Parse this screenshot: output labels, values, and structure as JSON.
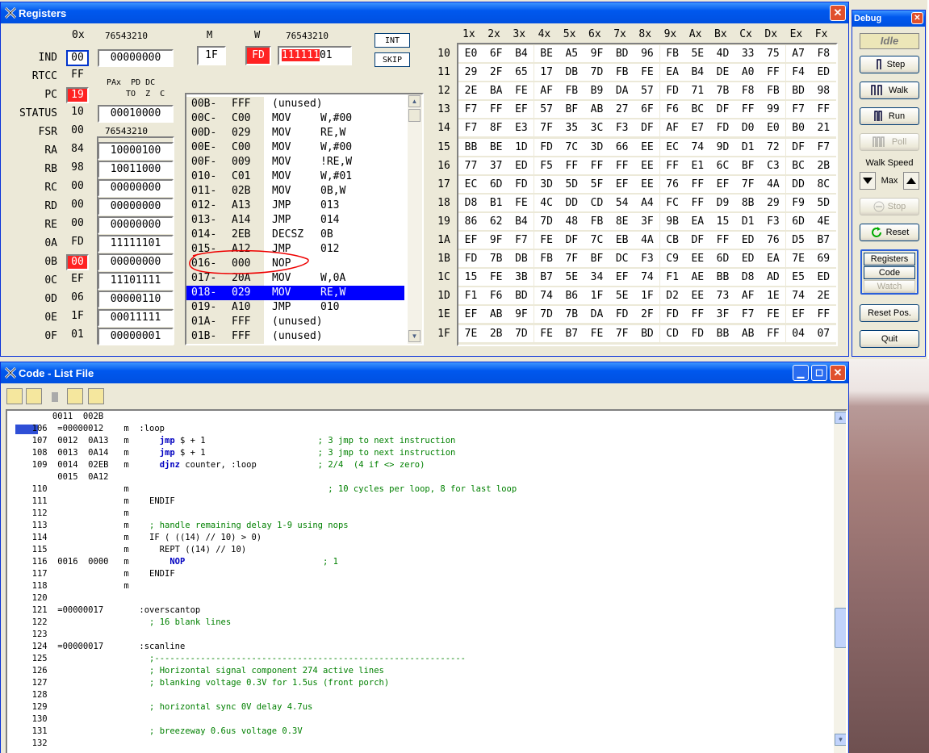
{
  "registers_window": {
    "title": "Registers",
    "hdr_0x": "0x",
    "hdr_bits1": "76543210",
    "hdr_m": "M",
    "hdr_w": "W",
    "hdr_bits2": "76543210",
    "m_value": "1F",
    "w_value": "FD",
    "w_binary_red": "111111",
    "w_binary_rest": "01",
    "btn_int": "INT",
    "btn_skip": "SKIP",
    "status_hdr1": "PAx  PD DC",
    "status_hdr2": "TO  Z  C",
    "hdr_bits3": "76543210",
    "regs": [
      {
        "name": "IND",
        "hex": "00",
        "bin": "00000000",
        "hexstyle": "blue"
      },
      {
        "name": "RTCC",
        "hex": "FF",
        "bin": "",
        "hexstyle": "flat"
      },
      {
        "name": "PC",
        "hex": "19",
        "bin": "",
        "hexstyle": "red"
      },
      {
        "name": "STATUS",
        "hex": "10",
        "bin": "00010000",
        "hexstyle": "flat"
      },
      {
        "name": "FSR",
        "hex": "00",
        "bin": "",
        "hexstyle": "flat"
      },
      {
        "name": "RA",
        "hex": "84",
        "bin": "10000100",
        "hexstyle": "flat"
      },
      {
        "name": "RB",
        "hex": "98",
        "bin": "10011000",
        "hexstyle": "flat"
      },
      {
        "name": "RC",
        "hex": "00",
        "bin": "00000000",
        "hexstyle": "flat"
      },
      {
        "name": "RD",
        "hex": "00",
        "bin": "00000000",
        "hexstyle": "flat"
      },
      {
        "name": "RE",
        "hex": "00",
        "bin": "00000000",
        "hexstyle": "flat"
      },
      {
        "name": "0A",
        "hex": "FD",
        "bin": "11111101",
        "hexstyle": "flat"
      },
      {
        "name": "0B",
        "hex": "00",
        "bin": "00000000",
        "hexstyle": "red"
      },
      {
        "name": "0C",
        "hex": "EF",
        "bin": "11101111",
        "hexstyle": "flat"
      },
      {
        "name": "0D",
        "hex": "06",
        "bin": "00000110",
        "hexstyle": "flat"
      },
      {
        "name": "0E",
        "hex": "1F",
        "bin": "00011111",
        "hexstyle": "flat"
      },
      {
        "name": "0F",
        "hex": "01",
        "bin": "00000001",
        "hexstyle": "flat"
      }
    ],
    "disasm": [
      {
        "addr": "00B-",
        "op": "FFF",
        "mn": "(unused)",
        "arg": ""
      },
      {
        "addr": "00C-",
        "op": "C00",
        "mn": "MOV",
        "arg": "W,#00"
      },
      {
        "addr": "00D-",
        "op": "029",
        "mn": "MOV",
        "arg": "RE,W"
      },
      {
        "addr": "00E-",
        "op": "C00",
        "mn": "MOV",
        "arg": "W,#00"
      },
      {
        "addr": "00F-",
        "op": "009",
        "mn": "MOV",
        "arg": "!RE,W"
      },
      {
        "addr": "010-",
        "op": "C01",
        "mn": "MOV",
        "arg": "W,#01"
      },
      {
        "addr": "011-",
        "op": "02B",
        "mn": "MOV",
        "arg": "0B,W"
      },
      {
        "addr": "012-",
        "op": "A13",
        "mn": "JMP",
        "arg": "013"
      },
      {
        "addr": "013-",
        "op": "A14",
        "mn": "JMP",
        "arg": "014"
      },
      {
        "addr": "014-",
        "op": "2EB",
        "mn": "DECSZ",
        "arg": "0B"
      },
      {
        "addr": "015-",
        "op": "A12",
        "mn": "JMP",
        "arg": "012"
      },
      {
        "addr": "016-",
        "op": "000",
        "mn": "NOP",
        "arg": ""
      },
      {
        "addr": "017-",
        "op": "20A",
        "mn": "MOV",
        "arg": "W,0A"
      },
      {
        "addr": "018-",
        "op": "029",
        "mn": "MOV",
        "arg": "RE,W"
      },
      {
        "addr": "019-",
        "op": "A10",
        "mn": "JMP",
        "arg": "010"
      },
      {
        "addr": "01A-",
        "op": "FFF",
        "mn": "(unused)",
        "arg": ""
      },
      {
        "addr": "01B-",
        "op": "FFF",
        "mn": "(unused)",
        "arg": ""
      }
    ],
    "disasm_selected": 13,
    "mem_cols": [
      "1x",
      "2x",
      "3x",
      "4x",
      "5x",
      "6x",
      "7x",
      "8x",
      "9x",
      "Ax",
      "Bx",
      "Cx",
      "Dx",
      "Ex",
      "Fx"
    ],
    "mem_rows": [
      {
        "label": "10",
        "vals": [
          "E0",
          "6F",
          "B4",
          "BE",
          "A5",
          "9F",
          "BD",
          "96",
          "FB",
          "5E",
          "4D",
          "33",
          "75",
          "A7",
          "F8"
        ]
      },
      {
        "label": "11",
        "vals": [
          "29",
          "2F",
          "65",
          "17",
          "DB",
          "7D",
          "FB",
          "FE",
          "EA",
          "B4",
          "DE",
          "A0",
          "FF",
          "F4",
          "ED"
        ]
      },
      {
        "label": "12",
        "vals": [
          "2E",
          "BA",
          "FE",
          "AF",
          "FB",
          "B9",
          "DA",
          "57",
          "FD",
          "71",
          "7B",
          "F8",
          "FB",
          "BD",
          "98"
        ]
      },
      {
        "label": "13",
        "vals": [
          "F7",
          "FF",
          "EF",
          "57",
          "BF",
          "AB",
          "27",
          "6F",
          "F6",
          "BC",
          "DF",
          "FF",
          "99",
          "F7",
          "FF"
        ]
      },
      {
        "label": "14",
        "vals": [
          "F7",
          "8F",
          "E3",
          "7F",
          "35",
          "3C",
          "F3",
          "DF",
          "AF",
          "E7",
          "FD",
          "D0",
          "E0",
          "B0",
          "21"
        ]
      },
      {
        "label": "15",
        "vals": [
          "BB",
          "BE",
          "1D",
          "FD",
          "7C",
          "3D",
          "66",
          "EE",
          "EC",
          "74",
          "9D",
          "D1",
          "72",
          "DF",
          "F7"
        ]
      },
      {
        "label": "16",
        "vals": [
          "77",
          "37",
          "ED",
          "F5",
          "FF",
          "FF",
          "FF",
          "EE",
          "FF",
          "E1",
          "6C",
          "BF",
          "C3",
          "BC",
          "2B"
        ]
      },
      {
        "label": "17",
        "vals": [
          "EC",
          "6D",
          "FD",
          "3D",
          "5D",
          "5F",
          "EF",
          "EE",
          "76",
          "FF",
          "EF",
          "7F",
          "4A",
          "DD",
          "8C"
        ]
      },
      {
        "label": "18",
        "vals": [
          "D8",
          "B1",
          "FE",
          "4C",
          "DD",
          "CD",
          "54",
          "A4",
          "FC",
          "FF",
          "D9",
          "8B",
          "29",
          "F9",
          "5D"
        ]
      },
      {
        "label": "19",
        "vals": [
          "86",
          "62",
          "B4",
          "7D",
          "48",
          "FB",
          "8E",
          "3F",
          "9B",
          "EA",
          "15",
          "D1",
          "F3",
          "6D",
          "4E"
        ]
      },
      {
        "label": "1A",
        "vals": [
          "EF",
          "9F",
          "F7",
          "FE",
          "DF",
          "7C",
          "EB",
          "4A",
          "CB",
          "DF",
          "FF",
          "ED",
          "76",
          "D5",
          "B7"
        ]
      },
      {
        "label": "1B",
        "vals": [
          "FD",
          "7B",
          "DB",
          "FB",
          "7F",
          "BF",
          "DC",
          "F3",
          "C9",
          "EE",
          "6D",
          "ED",
          "EA",
          "7E",
          "69"
        ]
      },
      {
        "label": "1C",
        "vals": [
          "15",
          "FE",
          "3B",
          "B7",
          "5E",
          "34",
          "EF",
          "74",
          "F1",
          "AE",
          "BB",
          "D8",
          "AD",
          "E5",
          "ED"
        ]
      },
      {
        "label": "1D",
        "vals": [
          "F1",
          "F6",
          "BD",
          "74",
          "B6",
          "1F",
          "5E",
          "1F",
          "D2",
          "EE",
          "73",
          "AF",
          "1E",
          "74",
          "2E"
        ]
      },
      {
        "label": "1E",
        "vals": [
          "EF",
          "AB",
          "9F",
          "7D",
          "7B",
          "DA",
          "FD",
          "2F",
          "FD",
          "FF",
          "3F",
          "F7",
          "FE",
          "EF",
          "FF"
        ]
      },
      {
        "label": "1F",
        "vals": [
          "7E",
          "2B",
          "7D",
          "FE",
          "B7",
          "FE",
          "7F",
          "BD",
          "CD",
          "FD",
          "BB",
          "AB",
          "FF",
          "04",
          "07"
        ]
      }
    ]
  },
  "debug_window": {
    "title": "Debug",
    "status": "Idle",
    "step": "Step",
    "walk": "Walk",
    "run": "Run",
    "poll": "Poll",
    "walk_speed_label": "Walk Speed",
    "max_label": "Max",
    "stop": "Stop",
    "reset": "Reset",
    "tab_registers": "Registers",
    "tab_code": "Code",
    "tab_watch": "Watch",
    "reset_pos": "Reset Pos.",
    "quit": "Quit"
  },
  "code_window": {
    "title": "Code - List File",
    "lines": [
      {
        "t": "      0011  002B",
        "c": ""
      },
      {
        "t": "  106  =00000012    m  :loop",
        "c": "",
        "sel": true
      },
      {
        "t": "  107  0012  0A13   m      ",
        "k": "jmp",
        "r": " $ + 1                      ",
        "c": "; 3 jmp to next instruction"
      },
      {
        "t": "  108  0013  0A14   m      ",
        "k": "jmp",
        "r": " $ + 1                      ",
        "c": "; 3 jmp to next instruction"
      },
      {
        "t": "  109  0014  02EB   m      ",
        "k": "djnz",
        "r": " counter, :loop            ",
        "c": "; 2/4  (4 if <> zero)"
      },
      {
        "t": "       0015  0A12",
        "c": ""
      },
      {
        "t": "  110               m                                       ",
        "c": "; 10 cycles per loop, 8 for last loop"
      },
      {
        "t": "  111               m    ENDIF",
        "c": ""
      },
      {
        "t": "  112               m",
        "c": ""
      },
      {
        "t": "  113               m    ",
        "c": "; handle remaining delay 1-9 using nops"
      },
      {
        "t": "  114               m    IF ( ((14) // 10) > 0)",
        "c": ""
      },
      {
        "t": "  115               m      REPT ((14) // 10)",
        "c": ""
      },
      {
        "t": "  116  0016  0000   m        ",
        "k": "NOP",
        "r": "                           ",
        "c": "; 1"
      },
      {
        "t": "  117               m    ENDIF",
        "c": ""
      },
      {
        "t": "  118               m",
        "c": ""
      },
      {
        "t": "  120",
        "c": ""
      },
      {
        "t": "  121  =00000017       :overscantop",
        "c": ""
      },
      {
        "t": "  122                    ",
        "c": "; 16 blank lines"
      },
      {
        "t": "  123",
        "c": ""
      },
      {
        "t": "  124  =00000017       :scanline",
        "c": ""
      },
      {
        "t": "  125                    ",
        "c": ";-------------------------------------------------------------"
      },
      {
        "t": "  126                    ",
        "c": "; Horizontal signal component 274 active lines"
      },
      {
        "t": "  127                    ",
        "c": "; blanking voltage 0.3V for 1.5us (front porch)"
      },
      {
        "t": "  128",
        "c": ""
      },
      {
        "t": "  129                    ",
        "c": "; horizontal sync 0V delay 4.7us"
      },
      {
        "t": "  130",
        "c": ""
      },
      {
        "t": "  131                    ",
        "c": "; breezeway 0.6us voltage 0.3V"
      },
      {
        "t": "  132",
        "c": ""
      }
    ]
  }
}
